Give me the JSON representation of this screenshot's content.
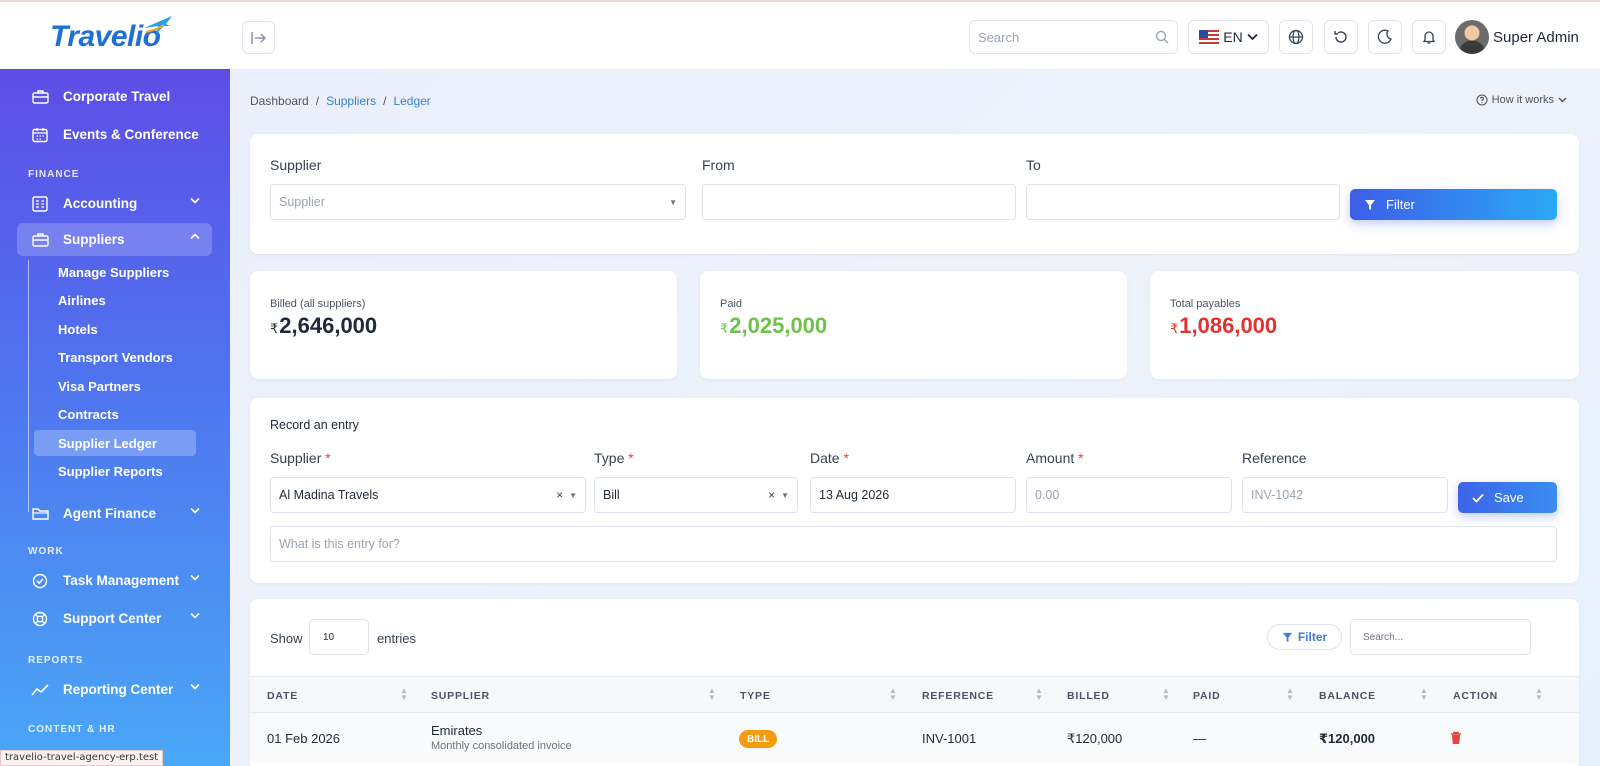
{
  "app": {
    "logo_text": "Travelio",
    "search_placeholder": "Search",
    "language": "EN",
    "user_name": "Super Admin"
  },
  "sidebar": {
    "top_items": [
      {
        "label": "Corporate Travel",
        "icon": "briefcase-icon"
      },
      {
        "label": "Events & Conference",
        "icon": "calendar-icon"
      }
    ],
    "finance_label": "FINANCE",
    "accounting_label": "Accounting",
    "suppliers_label": "Suppliers",
    "supplier_subitems": [
      "Manage Suppliers",
      "Airlines",
      "Hotels",
      "Transport Vendors",
      "Visa Partners",
      "Contracts",
      "Supplier Ledger",
      "Supplier Reports"
    ],
    "active_subitem": "Supplier Ledger",
    "agent_finance_label": "Agent Finance",
    "work_label": "WORK",
    "task_management_label": "Task Management",
    "support_center_label": "Support Center",
    "reports_label": "REPORTS",
    "reporting_center_label": "Reporting Center",
    "content_hr_label": "CONTENT & HR"
  },
  "status_url": "travelio-travel-agency-erp.test",
  "breadcrumb": {
    "items": [
      "Dashboard",
      "Suppliers",
      "Ledger"
    ],
    "separator": "/"
  },
  "how_it_works": "How it works",
  "filter_form": {
    "supplier_label": "Supplier",
    "supplier_placeholder": "Supplier",
    "from_label": "From",
    "to_label": "To",
    "filter_button": "Filter"
  },
  "stats": {
    "currency_symbol": "₹",
    "billed_label": "Billed (all suppliers)",
    "billed_value": "2,646,000",
    "paid_label": "Paid",
    "paid_value": "2,025,000",
    "payables_label": "Total payables",
    "payables_value": "1,086,000"
  },
  "entry_form": {
    "title": "Record an entry",
    "supplier_label": "Supplier",
    "supplier_value": "Al Madina Travels",
    "type_label": "Type",
    "type_value": "Bill",
    "date_label": "Date",
    "date_value": "13 Aug 2026",
    "amount_label": "Amount",
    "amount_placeholder": "0.00",
    "reference_label": "Reference",
    "reference_placeholder": "INV-1042",
    "required_mark": "*",
    "save_button": "Save",
    "description_placeholder": "What is this entry for?"
  },
  "table": {
    "show_label": "Show",
    "page_size": "10",
    "entries_label": "entries",
    "filter_label": "Filter",
    "search_placeholder": "Search...",
    "columns": [
      "DATE",
      "SUPPLIER",
      "TYPE",
      "REFERENCE",
      "BILLED",
      "PAID",
      "BALANCE",
      "ACTION"
    ],
    "rows": [
      {
        "date": "01 Feb 2026",
        "supplier": "Emirates",
        "supplier_note": "Monthly consolidated invoice",
        "type": "BILL",
        "reference": "INV-1001",
        "billed": "₹120,000",
        "paid": "—",
        "balance": "₹120,000"
      }
    ]
  },
  "colors": {
    "accent": "#3d5ee8",
    "paid": "#6cc24a",
    "payables": "#e0322f",
    "bill_badge": "#f39c12",
    "danger": "#e0453f"
  }
}
